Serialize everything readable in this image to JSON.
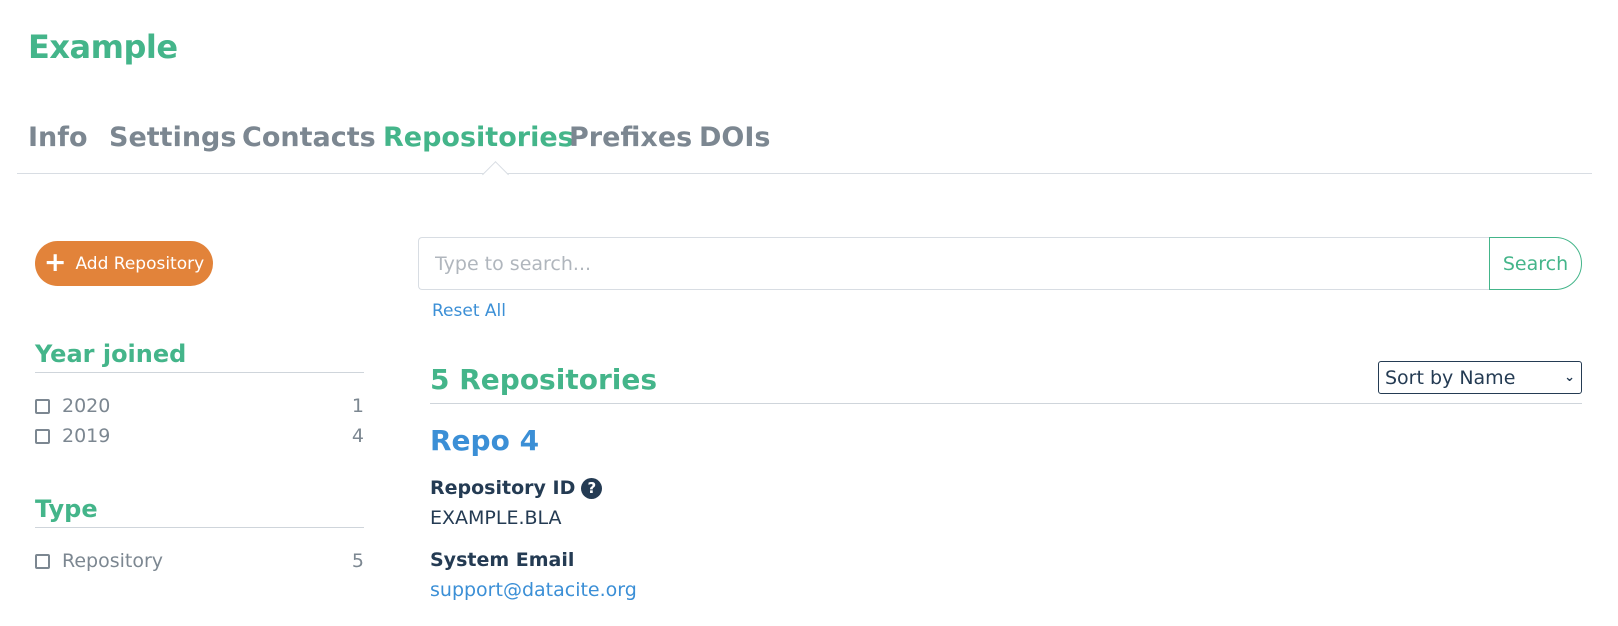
{
  "app": {
    "title": "Example"
  },
  "tabs": [
    {
      "label": "Info",
      "active": false
    },
    {
      "label": "Settings",
      "active": false
    },
    {
      "label": "Contacts",
      "active": false
    },
    {
      "label": "Repositories",
      "active": true
    },
    {
      "label": "Prefixes",
      "active": false
    },
    {
      "label": "DOIs",
      "active": false
    }
  ],
  "sidebar": {
    "add_button": {
      "label": "Add Repository",
      "icon": "plus-icon"
    },
    "facets": [
      {
        "title": "Year joined",
        "items": [
          {
            "label": "2020",
            "count": "1",
            "checked": false
          },
          {
            "label": "2019",
            "count": "4",
            "checked": false
          }
        ]
      },
      {
        "title": "Type",
        "items": [
          {
            "label": "Repository",
            "count": "5",
            "checked": false
          }
        ]
      }
    ]
  },
  "search": {
    "placeholder": "Type to search...",
    "value": "",
    "button_label": "Search",
    "reset_label": "Reset All"
  },
  "results": {
    "count_label": "5 Repositories",
    "sort": {
      "selected": "Sort by Name"
    },
    "items": [
      {
        "title": "Repo 4",
        "repository_id_label": "Repository ID",
        "repository_id": "EXAMPLE.BLA",
        "system_email_label": "System Email",
        "system_email": "support@datacite.org"
      }
    ]
  },
  "colors": {
    "accent": "#44b58a",
    "link": "#3b8fd6",
    "button": "#e2833a",
    "text": "#243b53",
    "muted": "#7c8791"
  }
}
